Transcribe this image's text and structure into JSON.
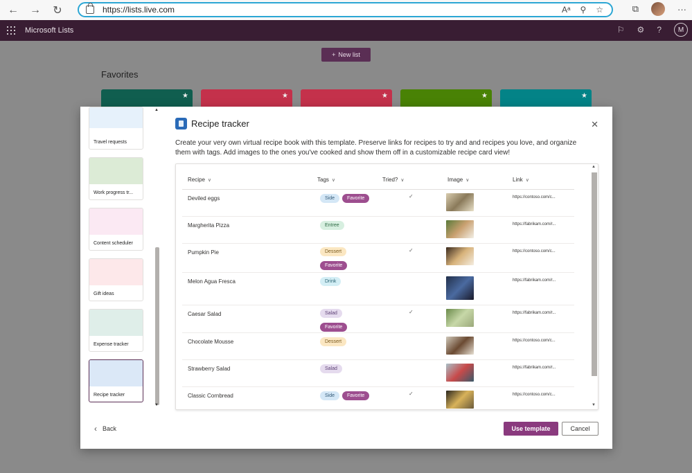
{
  "browser": {
    "url": "https://lists.live.com",
    "icons": [
      "back-icon",
      "forward-icon",
      "refresh-icon",
      "lock-icon",
      "read-aloud-icon",
      "zoom-icon",
      "favorites-add-icon",
      "collections-icon",
      "profile-icon",
      "more-icon"
    ],
    "read_aloud_glyph": "Aᵃ",
    "more_glyph": "···"
  },
  "app": {
    "title": "Microsoft Lists",
    "avatar_initial": "M",
    "icons": [
      "waffle-icon",
      "feedback-icon",
      "settings-icon",
      "help-icon"
    ]
  },
  "page": {
    "new_list_label": "New list",
    "favorites_title": "Favorites",
    "favorite_card_colors": [
      "#105e4f",
      "#c4314b",
      "#c4314b",
      "#498205",
      "#038387"
    ]
  },
  "modal": {
    "title": "Recipe tracker",
    "description": "Create your very own virtual recipe book with this template. Preserve links for recipes to try and and recipes you love, and organize them with tags. Add images to the ones you've cooked and show them off in a customizable recipe card view!",
    "templates": [
      {
        "label": "Travel requests"
      },
      {
        "label": "Work progress tr..."
      },
      {
        "label": "Content scheduler"
      },
      {
        "label": "Gift ideas"
      },
      {
        "label": "Expense tracker"
      },
      {
        "label": "Recipe tracker",
        "selected": true
      }
    ],
    "columns": [
      "Recipe",
      "Tags",
      "Tried?",
      "Image",
      "Link"
    ],
    "rows": [
      {
        "recipe": "Deviled eggs",
        "tags": [
          "Side",
          "Favorite"
        ],
        "tried": true,
        "link": "https://contoso.com/c..."
      },
      {
        "recipe": "Margherita Pizza",
        "tags": [
          "Entree"
        ],
        "tried": false,
        "link": "https://fabrikam.com/r..."
      },
      {
        "recipe": "Pumpkin Pie",
        "tags": [
          "Dessert",
          "Favorite"
        ],
        "tried": true,
        "link": "https://contoso.com/c..."
      },
      {
        "recipe": "Melon Agua Fresca",
        "tags": [
          "Drink"
        ],
        "tried": false,
        "link": "https://fabrikam.com/r..."
      },
      {
        "recipe": "Caesar Salad",
        "tags": [
          "Salad",
          "Favorite"
        ],
        "tried": true,
        "link": "https://fabrikam.com/r..."
      },
      {
        "recipe": "Chocolate Mousse",
        "tags": [
          "Dessert"
        ],
        "tried": false,
        "link": "https://contoso.com/c..."
      },
      {
        "recipe": "Strawberry Salad",
        "tags": [
          "Salad"
        ],
        "tried": false,
        "link": "https://fabrikam.com/r..."
      },
      {
        "recipe": "Classic Cornbread",
        "tags": [
          "Side",
          "Favorite"
        ],
        "tried": true,
        "link": "https://contoso.com/c..."
      }
    ],
    "back_label": "Back",
    "use_template_label": "Use template",
    "cancel_label": "Cancel"
  },
  "colors": {
    "accent": "#8a3a7e",
    "app_bar": "#391d33",
    "new_list_button": "#5a2e54"
  }
}
